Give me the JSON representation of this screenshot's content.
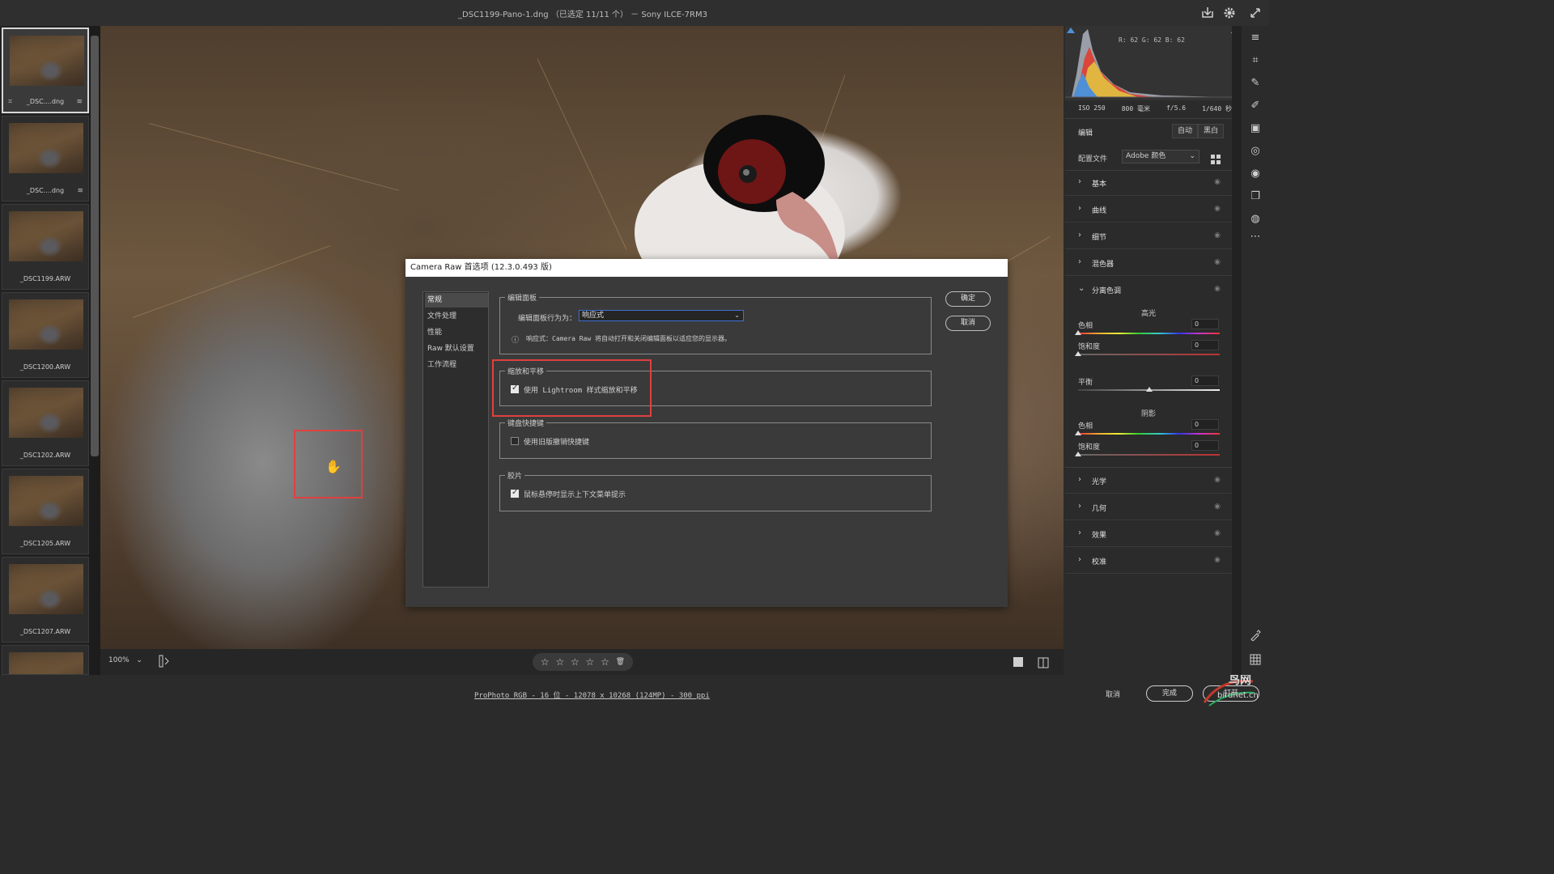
{
  "window": {
    "title": "_DSC1199-Pano-1.dng （已选定 11/11 个） －  Sony ILCE-7RM3"
  },
  "filmstrip": {
    "items": [
      {
        "name": "_DSC....dng",
        "left_icon": "crop-icon",
        "right_icon": "adjust-icon",
        "selected": true
      },
      {
        "name": "_DSC....dng",
        "left_icon": "",
        "right_icon": "adjust-icon",
        "selected": false
      },
      {
        "name": "_DSC1199.ARW",
        "left_icon": "",
        "right_icon": "",
        "selected": false
      },
      {
        "name": "_DSC1200.ARW",
        "left_icon": "",
        "right_icon": "",
        "selected": false
      },
      {
        "name": "_DSC1202.ARW",
        "left_icon": "",
        "right_icon": "",
        "selected": false
      },
      {
        "name": "_DSC1205.ARW",
        "left_icon": "",
        "right_icon": "",
        "selected": false
      },
      {
        "name": "_DSC1207.ARW",
        "left_icon": "",
        "right_icon": "",
        "selected": false
      }
    ],
    "glyphs": {
      "crop": "⌗",
      "adjust": "≋"
    }
  },
  "bottombar": {
    "zoom": "100%",
    "zoom_caret": "⌄",
    "rating_stars": [
      "☆",
      "☆",
      "☆",
      "☆",
      "☆"
    ],
    "trash": "🗑"
  },
  "status": {
    "color_info": "ProPhoto RGB - 16 位 - 12078 x 10268 (124MP) - 300 ppi",
    "cancel": "取消",
    "done": "完成",
    "open": "打开"
  },
  "watermark": {
    "text1": "鸟网",
    "text2": "birdnet.cn"
  },
  "histogram": {
    "readout": "R: 62    G: 62    B: 62"
  },
  "exif": {
    "iso": "ISO 250",
    "focal": "800 毫米",
    "aperture": "f/5.6",
    "shutter": "1/640 秒"
  },
  "edit": {
    "label": "编辑",
    "auto": "自动",
    "bw": "黑白",
    "profile_label": "配置文件",
    "profile_value": "Adobe 颜色",
    "profile_caret": "⌄"
  },
  "sections_top": [
    {
      "label": "基本"
    },
    {
      "label": "曲线"
    },
    {
      "label": "细节"
    },
    {
      "label": "混色器"
    }
  ],
  "split_toning": {
    "label": "分离色调",
    "highlights": "高光",
    "hue": "色相",
    "saturation": "饱和度",
    "balance": "平衡",
    "shadows": "阴影",
    "hl_hue": "0",
    "hl_sat": "0",
    "balance_val": "0",
    "sh_hue": "0",
    "sh_sat": "0",
    "balance_level": 0.5
  },
  "sections_bottom": [
    {
      "label": "光学"
    },
    {
      "label": "几何"
    },
    {
      "label": "效果"
    },
    {
      "label": "校准"
    }
  ],
  "chevrons": {
    "right": "›",
    "down": "⌄"
  },
  "eye_glyph": "◉",
  "dialog": {
    "title": "Camera Raw 首选项 (12.3.0.493 版)",
    "nav": [
      "常规",
      "文件处理",
      "性能",
      "Raw 默认设置",
      "工作流程"
    ],
    "nav_selected": 0,
    "groups": {
      "edit_panel": {
        "title": "编辑面板",
        "behavior_label": "编辑面板行为为：",
        "behavior_value": "响应式",
        "info": "响应式：Camera Raw 将自动打开和关闭编辑面板以适应您的显示器。",
        "info_icon": "ⓘ"
      },
      "zoom_pan": {
        "title": "缩放和平移",
        "checkbox_label": "使用 Lightroom 样式缩放和平移",
        "checked": true
      },
      "shortcuts": {
        "title": "键盘快捷键",
        "checkbox_label": "使用旧版撤销快捷键",
        "checked": false
      },
      "filmstrip": {
        "title": "胶片",
        "checkbox_label": "鼠标悬停时显示上下文菜单提示",
        "checked": true
      }
    },
    "ok": "确定",
    "cancel": "取消"
  },
  "tools": [
    "sliders-icon",
    "crop-icon",
    "heal-icon",
    "brush-icon",
    "gradient-icon",
    "radial-icon",
    "redeye-icon",
    "snapshots-icon",
    "presets-icon",
    "more-icon"
  ],
  "tool_glyphs": [
    "≡",
    "⌗",
    "✎",
    "✐",
    "▣",
    "◎",
    "◉",
    "❐",
    "◍",
    "⋯"
  ]
}
